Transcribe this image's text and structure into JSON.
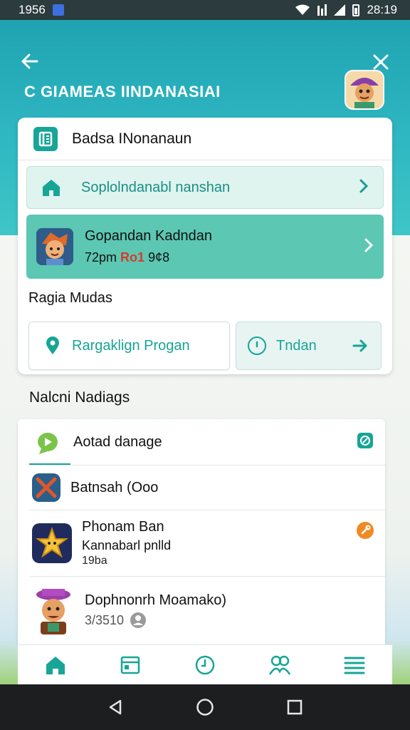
{
  "status_bar": {
    "time_left": "1956",
    "time_right": "28:19"
  },
  "header": {
    "title": "C GIAMEAS IINDANASIAI",
    "back_icon": "arrow-left-icon",
    "expand_icon": "expand-icon"
  },
  "card": {
    "title": "Badsa INonanaun",
    "primary_row": {
      "label": "Soplolndanabl nanshan"
    },
    "featured": {
      "title": "Gopandan Kadndan",
      "sub_prefix": "72pm",
      "sub_highlight": "Ro1",
      "sub_suffix": "9¢8",
      "highlight_color": "#d83a2b"
    },
    "section_title": "Ragia Mudas",
    "button_a": {
      "label": "Rargaklign Progan"
    },
    "button_b": {
      "label": "Tndan"
    }
  },
  "list": {
    "title": "Nalcni Nadiags",
    "items": [
      {
        "title": "Aotad danage"
      },
      {
        "title": "Batnsah (Ooo"
      },
      {
        "title": "Phonam Ban",
        "line2": "Kannabarl pnlld",
        "line3": "19ba"
      },
      {
        "title": "Dophnonrh Moamako)",
        "line2": "3/3510"
      }
    ]
  },
  "colors": {
    "accent": "#17a596",
    "header": "#1fa3b2",
    "featured_bg": "#5cc7b3"
  }
}
